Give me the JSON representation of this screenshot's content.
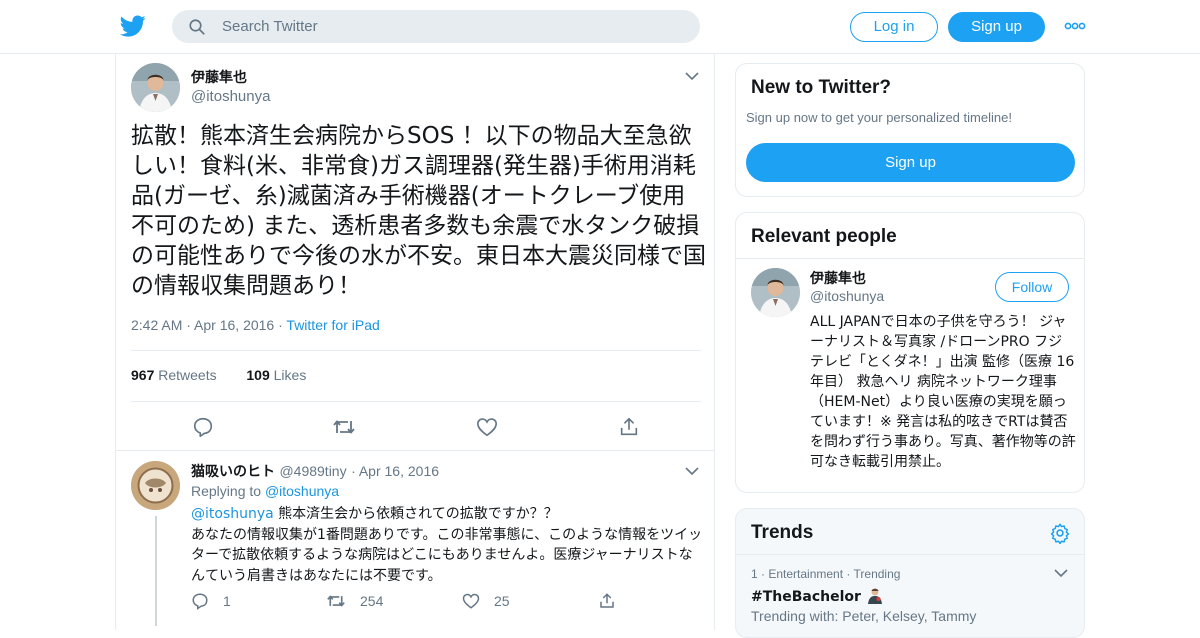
{
  "header": {
    "search_placeholder": "Search Twitter",
    "login_label": "Log in",
    "signup_label": "Sign up"
  },
  "tweet": {
    "name": "伊藤隼也",
    "handle": "@itoshunya",
    "text": "拡散！熊本済生会病院からSOS ！以下の物品大至急欲しい！食料(米、非常食)ガス調理器(発生器)手術用消耗品(ガーゼ、糸)滅菌済み手術機器(オートクレーブ使用不可のため) また、透析患者多数も余震で水タンク破損の可能性ありで今後の水が不安。東日本大震災同様で国の情報収集問題あり！",
    "time": "2:42 AM",
    "date": "Apr 16, 2016",
    "source": "Twitter for iPad",
    "retweets_count": "967",
    "retweets_label": "Retweets",
    "likes_count": "109",
    "likes_label": "Likes"
  },
  "reply": {
    "name": "猫吸いのヒト",
    "handle": "@4989tiny",
    "date": "Apr 16, 2016",
    "replying_prefix": "Replying to",
    "replying_to": "@itoshunya",
    "mention": "@itoshunya",
    "text_line1": " 熊本済生会から依頼されての拡散ですか？？",
    "text_rest": "あなたの情報収集が1番問題ありです。この非常事態に、このような情報をツイッターで拡散依頼するような病院はどこにもありませんよ。医療ジャーナリストなんていう肩書きはあなたには不要です。",
    "replies": "1",
    "retweets": "254",
    "likes": "25"
  },
  "new_to_twitter": {
    "title": "New to Twitter?",
    "subtitle": "Sign up now to get your personalized timeline!",
    "button": "Sign up"
  },
  "relevant_people": {
    "title": "Relevant people",
    "name": "伊藤隼也",
    "handle": "@itoshunya",
    "follow": "Follow",
    "bio": "ALL JAPANで日本の子供を守ろう！ ジャーナリスト＆写真家 /ドローンPRO フジテレビ「とくダネ！」出演 監修（医療 16年目） 救急ヘリ 病院ネットワーク理事（HEM-Net）より良い医療の実現を願っています！※ 発言は私的呟きでRTは賛否を問わず行う事あり。写真、著作物等の許可なき転載引用禁止。"
  },
  "trends": {
    "title": "Trends",
    "item": {
      "rank": "1",
      "category": "Entertainment",
      "status": "Trending",
      "name": "#TheBachelor",
      "trending_with": "Trending with: Peter, Kelsey, Tammy"
    }
  },
  "colors": {
    "accent": "#1da1f2",
    "link": "#1b95e0",
    "muted": "#657786",
    "border": "#e6ecf0"
  }
}
